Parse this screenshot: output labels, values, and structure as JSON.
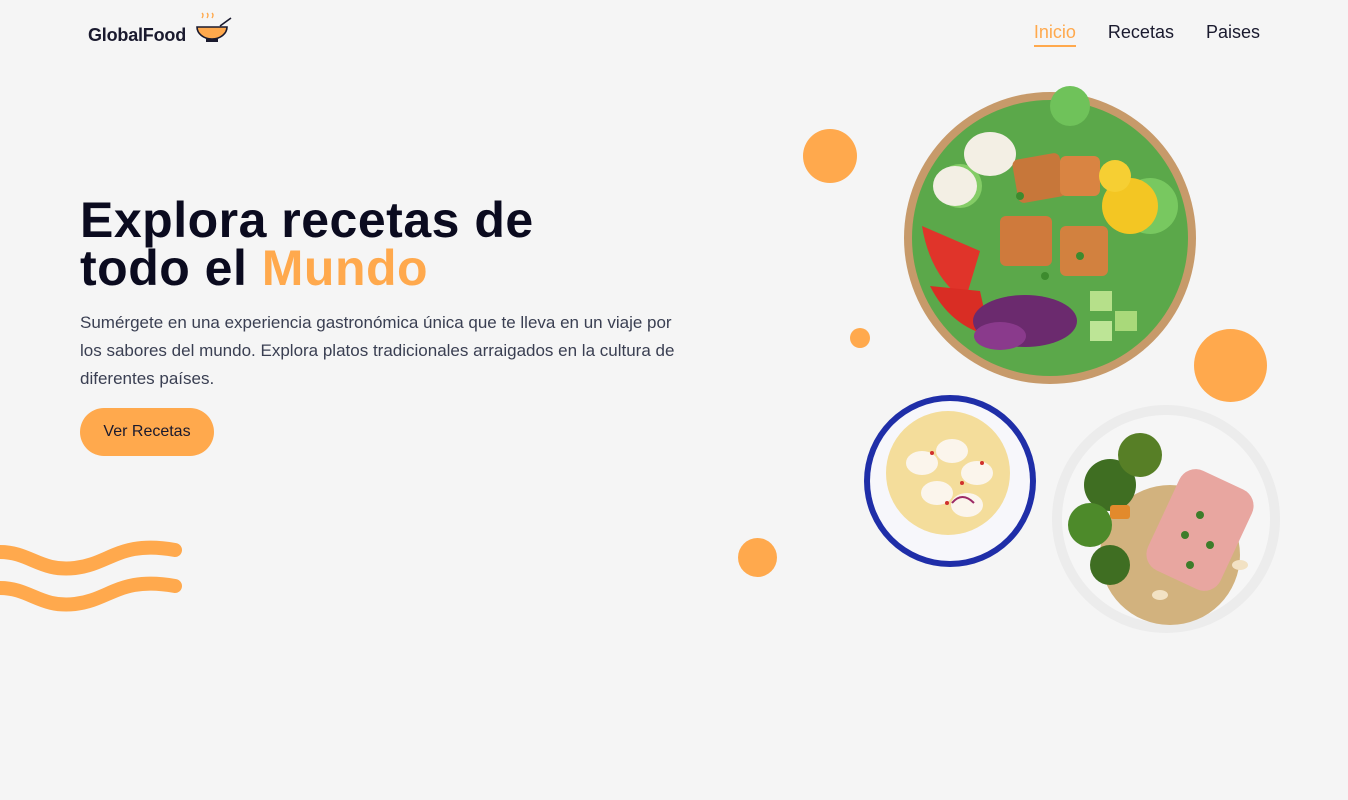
{
  "brand": {
    "name": "GlobalFood",
    "icon": "soup-bowl-icon"
  },
  "nav": {
    "items": [
      {
        "label": "Inicio",
        "active": true
      },
      {
        "label": "Recetas",
        "active": false
      },
      {
        "label": "Paises",
        "active": false
      }
    ]
  },
  "hero": {
    "title_line1": "Explora recetas de",
    "title_line2_prefix": "todo el ",
    "title_accent": "Mundo",
    "description": "Sumérgete en una experiencia gastronómica única que te lleva en un viaje por los sabores del mundo. Explora platos tradicionales arraigados en la cultura de diferentes países.",
    "cta_label": "Ver Recetas"
  },
  "images": [
    {
      "name": "salad-bowl-image",
      "icon": "salad-bowl"
    },
    {
      "name": "ceviche-bowl-image",
      "icon": "ceviche-bowl"
    },
    {
      "name": "salmon-plate-image",
      "icon": "salmon-plate"
    }
  ],
  "colors": {
    "accent": "#ffa94d",
    "background": "#f5f5f5",
    "text_dark": "#0b0b1f",
    "text_body": "#3a3f52"
  }
}
